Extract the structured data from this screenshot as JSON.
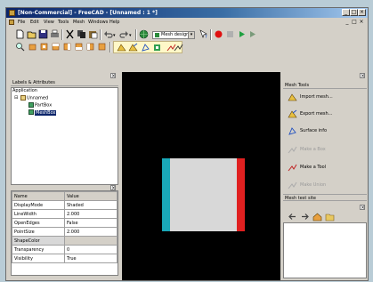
{
  "window": {
    "title": "[Non-Commercial] - FreeCAD - [Unnamed : 1 *]"
  },
  "menubar": {
    "items": [
      "File",
      "Edit",
      "View",
      "Tools",
      "Mesh",
      "Windows",
      "Help"
    ]
  },
  "toolbar": {
    "workbench_selector": "Mesh design"
  },
  "tree_panel": {
    "title": "Labels & Attributes",
    "root_label": "Application",
    "document": "Unnamed",
    "children": [
      "PartBox",
      "MeshBox"
    ],
    "selected": "MeshBox"
  },
  "properties_panel": {
    "headers": [
      "Name",
      "Value"
    ],
    "rows": [
      {
        "name": "DisplayMode",
        "value": "Shaded"
      },
      {
        "name": "LineWidth",
        "value": "2.000"
      },
      {
        "name": "OpenEdges",
        "value": "False"
      },
      {
        "name": "PointSize",
        "value": "2.000"
      },
      {
        "name": "ShapeColor",
        "value": ""
      },
      {
        "name": "Transparency",
        "value": "0"
      },
      {
        "name": "Visibility",
        "value": "True"
      }
    ]
  },
  "mesh_tools": {
    "title": "Mesh Tools",
    "items": [
      {
        "label": "Import mesh...",
        "icon": "import-mesh-icon",
        "enabled": true
      },
      {
        "label": "Export mesh...",
        "icon": "export-mesh-icon",
        "enabled": true
      },
      {
        "label": "Surface info",
        "icon": "surface-info-icon",
        "enabled": true
      },
      {
        "label": "Make a Box",
        "icon": "make-box-icon",
        "enabled": false
      },
      {
        "label": "Make a Tool",
        "icon": "make-tool-icon",
        "enabled": true
      },
      {
        "label": "Make Union",
        "icon": "make-union-icon",
        "enabled": false
      }
    ],
    "test_site_label": "Mesh test site"
  },
  "colors": {
    "viewport_background": "#000000",
    "box_face": "#d8d8d8",
    "box_left_edge": "#1aa8b8",
    "box_right_edge": "#e02020",
    "selection": "#0a246a"
  }
}
